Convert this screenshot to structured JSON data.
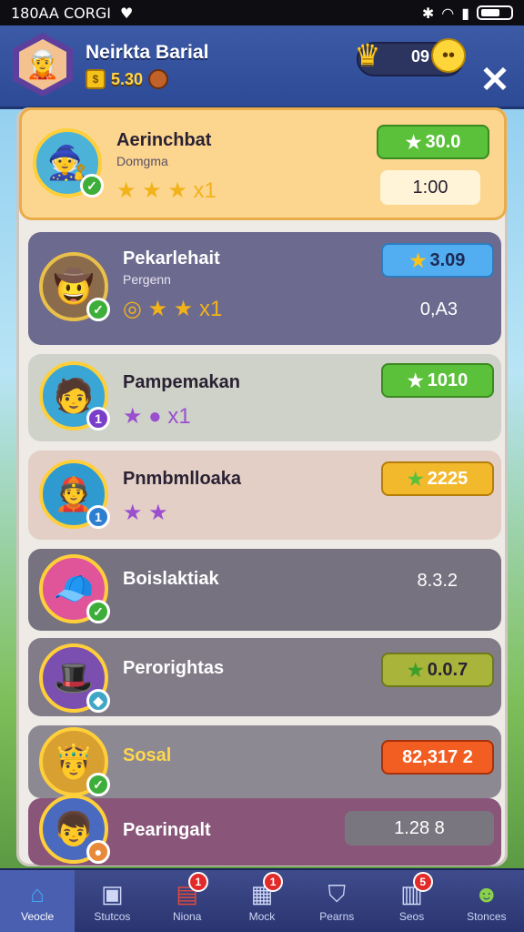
{
  "status_bar": {
    "time": "180AA CORGI",
    "icons": [
      "heart-icon",
      "bluetooth-icon",
      "wifi-icon",
      "signal-icon",
      "battery-icon"
    ]
  },
  "header": {
    "player_name": "Neirkta Barial",
    "coins": "5.30",
    "currency_value": "09",
    "close": "✕"
  },
  "rows": [
    {
      "name": "Aerinchbat",
      "sub": "Domgma",
      "score": "30.0",
      "secondary": "1:00",
      "avatar": "🧙",
      "badge": "✓",
      "stars": "★ ★ ★ x1"
    },
    {
      "name": "Pekarlehait",
      "sub": "Pergenn",
      "score": "3.09",
      "secondary": "0,A3",
      "avatar": "🤠",
      "badge": "✓",
      "stars": "◎ ★ ★ x1"
    },
    {
      "name": "Pampemakan",
      "sub": "",
      "score": "1010",
      "secondary": "",
      "avatar": "🧑",
      "badge": "1",
      "stars": "★ ● x1"
    },
    {
      "name": "Pnmbmlloaka",
      "sub": "",
      "score": "2225",
      "secondary": "",
      "avatar": "👲",
      "badge": "1",
      "stars": "★ ★"
    },
    {
      "name": "Boislaktiak",
      "sub": "",
      "score": "",
      "secondary": "8.3.2",
      "avatar": "🧢",
      "badge": "✓",
      "stars": ""
    },
    {
      "name": "Perorightas",
      "sub": "",
      "score": "0.0.7",
      "secondary": "",
      "avatar": "🎩",
      "badge": "◆",
      "stars": ""
    },
    {
      "name": "Sosal",
      "sub": "",
      "score": "82,317 2",
      "secondary": "",
      "avatar": "🤴",
      "badge": "✓",
      "stars": ""
    },
    {
      "name": "Pearingalt",
      "sub": "",
      "score": "1.28 8",
      "secondary": "",
      "avatar": "👦",
      "badge": "●",
      "stars": ""
    }
  ],
  "nav": [
    {
      "label": "Veocle",
      "icon": "home-icon",
      "badge": ""
    },
    {
      "label": "Stutcos",
      "icon": "cube-icon",
      "badge": ""
    },
    {
      "label": "Niona",
      "icon": "box-icon",
      "badge": "1"
    },
    {
      "label": "Mock",
      "icon": "crate-icon",
      "badge": "1"
    },
    {
      "label": "Pearns",
      "icon": "shield-icon",
      "badge": ""
    },
    {
      "label": "Seos",
      "icon": "chest-icon",
      "badge": "5"
    },
    {
      "label": "Stonces",
      "icon": "smiley-icon",
      "badge": ""
    }
  ],
  "colors": {
    "accent_green": "#5fc43a",
    "accent_blue": "#3ea4ec",
    "accent_yellow": "#f2b62a",
    "accent_olive": "#a9b43a",
    "accent_orange": "#f25e22"
  }
}
